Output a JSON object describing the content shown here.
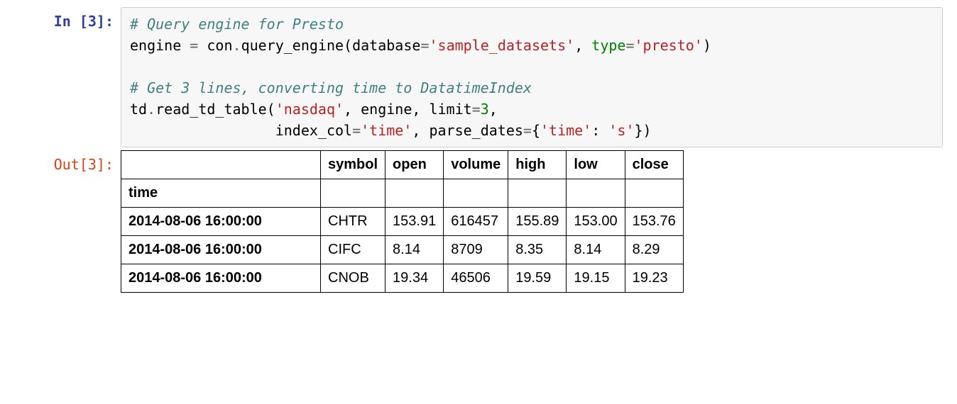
{
  "prompts": {
    "in": "In [3]:",
    "out": "Out[3]:"
  },
  "code": {
    "c1": "# Query engine for Presto",
    "l2a": "engine ",
    "l2b": "=",
    "l2c": " con",
    "l2d": ".",
    "l2e": "query_engine(database",
    "l2f": "=",
    "l2g": "'sample_datasets'",
    "l2h": ", ",
    "l2i": "type",
    "l2j": "=",
    "l2k": "'presto'",
    "l2l": ")",
    "c2": "# Get 3 lines, converting time to DatatimeIndex",
    "l4a": "td",
    "l4b": ".",
    "l4c": "read_td_table(",
    "l4d": "'nasdaq'",
    "l4e": ", engine, limit",
    "l4f": "=",
    "l4g": "3",
    "l4h": ",",
    "l5pad": "                 ",
    "l5a": "index_col",
    "l5b": "=",
    "l5c": "'time'",
    "l5d": ", parse_dates",
    "l5e": "=",
    "l5f": "{",
    "l5g": "'time'",
    "l5h": ": ",
    "l5i": "'s'",
    "l5j": "})"
  },
  "table": {
    "index_name": "time",
    "columns": [
      "symbol",
      "open",
      "volume",
      "high",
      "low",
      "close"
    ],
    "rows": [
      {
        "idx": "2014-08-06 16:00:00",
        "cells": [
          "CHTR",
          "153.91",
          "616457",
          "155.89",
          "153.00",
          "153.76"
        ]
      },
      {
        "idx": "2014-08-06 16:00:00",
        "cells": [
          "CIFC",
          "8.14",
          "8709",
          "8.35",
          "8.14",
          "8.29"
        ]
      },
      {
        "idx": "2014-08-06 16:00:00",
        "cells": [
          "CNOB",
          "19.34",
          "46506",
          "19.59",
          "19.15",
          "19.23"
        ]
      }
    ]
  }
}
